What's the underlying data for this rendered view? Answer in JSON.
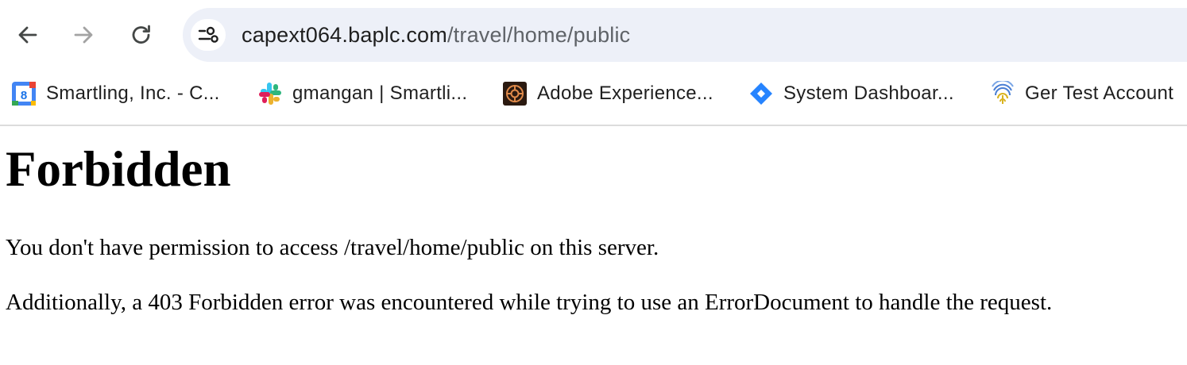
{
  "browser": {
    "url_host": "capext064.baplc.com",
    "url_path": "/travel/home/public",
    "bookmarks": [
      {
        "label": "Smartling, Inc. - C...",
        "icon": "google-calendar-icon"
      },
      {
        "label": "gmangan | Smartli...",
        "icon": "slack-icon"
      },
      {
        "label": "Adobe Experience...",
        "icon": "adobe-experience-icon"
      },
      {
        "label": "System Dashboar...",
        "icon": "jira-icon"
      },
      {
        "label": "Ger Test Account",
        "icon": "fingerprint-icon"
      }
    ],
    "colors": {
      "omnibox_bg": "#edf0f8",
      "toolbar_bg": "#ffffff"
    }
  },
  "page": {
    "heading": "Forbidden",
    "paragraph_1": "You don't have permission to access /travel/home/public on this server.",
    "paragraph_2": "Additionally, a 403 Forbidden error was encountered while trying to use an ErrorDocument to handle the request."
  }
}
